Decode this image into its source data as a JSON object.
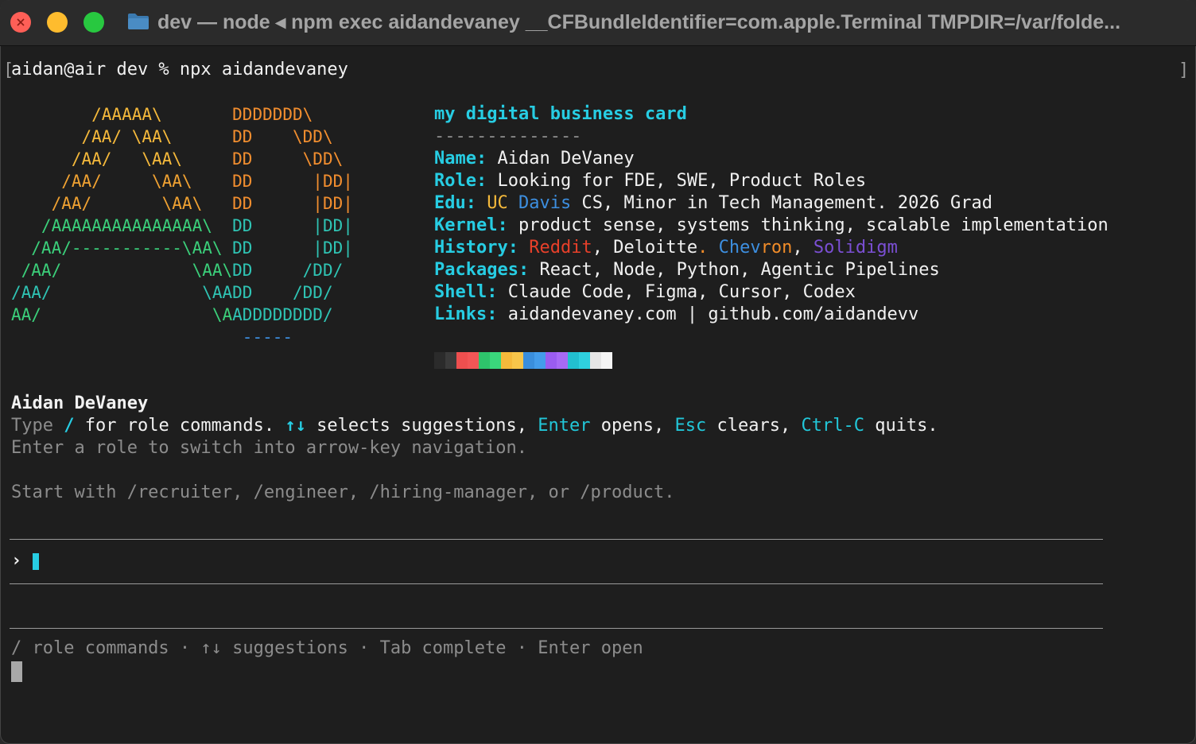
{
  "window": {
    "title": "dev — node ◂ npm exec aidandevaney __CFBundleIdentifier=com.apple.Terminal TMPDIR=/var/folde..."
  },
  "terminal": {
    "command_line": "aidan@air dev % npx aidandevaney",
    "open_bracket": "[",
    "close_bracket": "]",
    "ascii_art": [
      {
        "a": "        /AAAAA\\       ",
        "d": "DDDDDDD\\"
      },
      {
        "a": "       /AA/ \\AA\\      ",
        "d": "DD    \\DD\\"
      },
      {
        "a": "      /AA/   \\AA\\     ",
        "d": "DD     \\DD\\"
      },
      {
        "a": "     /AA/     \\AA\\    ",
        "d": "DD      |DD|"
      },
      {
        "a": "    /AA/       \\AA\\   ",
        "d": "DD      |DD|"
      },
      {
        "a": "   /AAAAAAAAAAAAAAA\\  ",
        "d": "DD      |DD|"
      },
      {
        "a": "  /AA/-----------\\AA\\ ",
        "d": "DD      |DD|"
      },
      {
        "a": " /AA/             \\AA\\",
        "d": "DD     /DD/"
      },
      {
        "a": "/AA/               \\AA",
        "d": "DD    /DD/"
      },
      {
        "a": "AA/                 \\A",
        "d": "ADDDDDDDD/"
      },
      {
        "a": "                       ",
        "d": "-----"
      }
    ],
    "card": {
      "heading": "my digital business card",
      "divider": "--------------",
      "name_key": "Name:",
      "name_val": "Aidan DeVaney",
      "role_key": "Role:",
      "role_val": "Looking for FDE, SWE, Product Roles",
      "edu_key": "Edu:",
      "edu_uc": "UC",
      "edu_davis": "Davis",
      "edu_rest": "CS, Minor in Tech Management. 2026 Grad",
      "kernel_key": "Kernel:",
      "kernel_val": "product sense, systems thinking, scalable implementation",
      "history_key": "History:",
      "history_reddit": "Reddit",
      "history_comma1": ", ",
      "history_deloitte": "Deloitte",
      "history_dot": ".",
      "history_chev": "Chev",
      "history_ron": "ron",
      "history_comma2": ", ",
      "history_solidigm": "Solidigm",
      "packages_key": "Packages:",
      "packages_val": "React, Node, Python, Agentic Pipelines",
      "shell_key": "Shell:",
      "shell_val": "Claude Code, Figma, Cursor, Codex",
      "links_key": "Links:",
      "links_val": "aidandevaney.com | github.com/aidandevv"
    },
    "swatch_colors": [
      "#2b2b2b",
      "#3a3a3a",
      "#ee4f4f",
      "#f25656",
      "#2ec36b",
      "#3ad67c",
      "#f5b93b",
      "#f7c54a",
      "#3a8edc",
      "#449cea",
      "#9a5cf0",
      "#a76af5",
      "#22bfcf",
      "#2fd0df",
      "#e6e6e6",
      "#f5f5f5"
    ],
    "intro": {
      "name": "Aidan DeVaney",
      "l1_type": "Type ",
      "l1_slash": "/",
      "l1_for": " for role commands. ",
      "l1_arrows": "↑↓",
      "l1_selects": " selects suggestions, ",
      "l1_enter": "Enter",
      "l1_opens": " opens, ",
      "l1_esc": "Esc",
      "l1_clears": " clears, ",
      "l1_ctrlc": "Ctrl-C",
      "l1_quits": " quits.",
      "l2": "Enter a role to switch into arrow-key navigation.",
      "l3": "Start with /recruiter, /engineer, /hiring-manager, or /product."
    },
    "prompt": {
      "caret": "›",
      "value": ""
    },
    "footer_hint": "/ role commands · ↑↓ suggestions · Tab complete · Enter open"
  }
}
